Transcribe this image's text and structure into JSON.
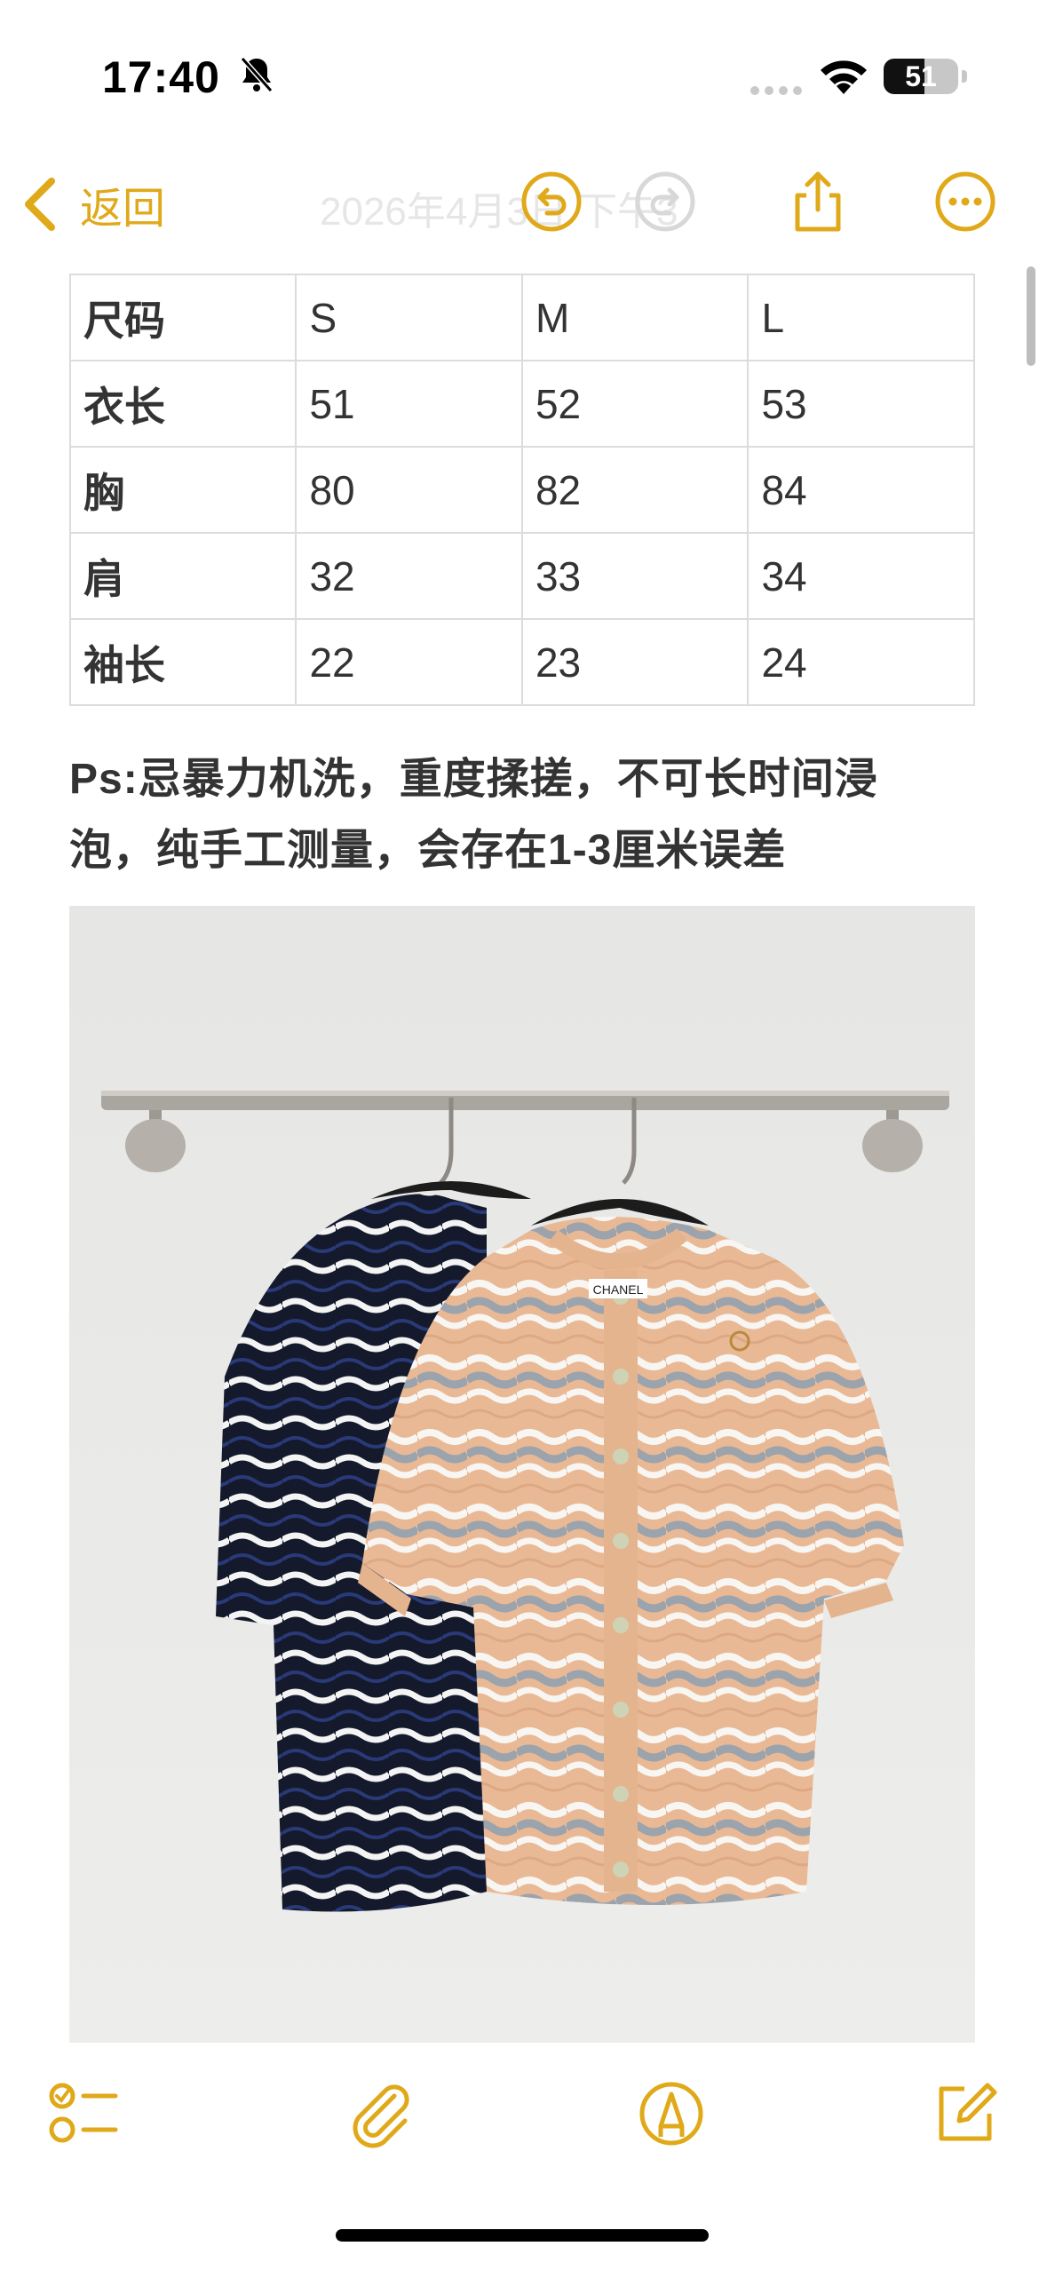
{
  "status_bar": {
    "time": "17:40",
    "battery": "51",
    "icons": [
      "bell-slash-icon",
      "signal-icon",
      "wifi-icon",
      "battery-icon"
    ]
  },
  "nav": {
    "back_label": "返回",
    "title_faded": "2026年4月3日 下午3",
    "icons": [
      "undo-icon",
      "redo-icon",
      "share-icon",
      "more-icon"
    ]
  },
  "size_table": {
    "header": [
      "尺码",
      "S",
      "M",
      "L"
    ],
    "rows": [
      [
        "衣长",
        "51",
        "52",
        "53"
      ],
      [
        "胸",
        "80",
        "82",
        "84"
      ],
      [
        "肩",
        "32",
        "33",
        "34"
      ],
      [
        "袖长",
        "22",
        "23",
        "24"
      ]
    ]
  },
  "note": {
    "line1": "Ps:忌暴力机洗，重度揉搓，不可长时间浸",
    "line2": "泡，纯手工测量，会存在1-3厘米误差"
  },
  "photo": {
    "tag_text": "CHANEL"
  },
  "toolbar": {
    "icons": [
      "checklist-icon",
      "attachment-icon",
      "markup-icon",
      "compose-icon"
    ]
  },
  "colors": {
    "accent": "#e0a919",
    "beige": "#e9b996",
    "grey": "#9ba3ad",
    "navy": "#141a2c"
  }
}
